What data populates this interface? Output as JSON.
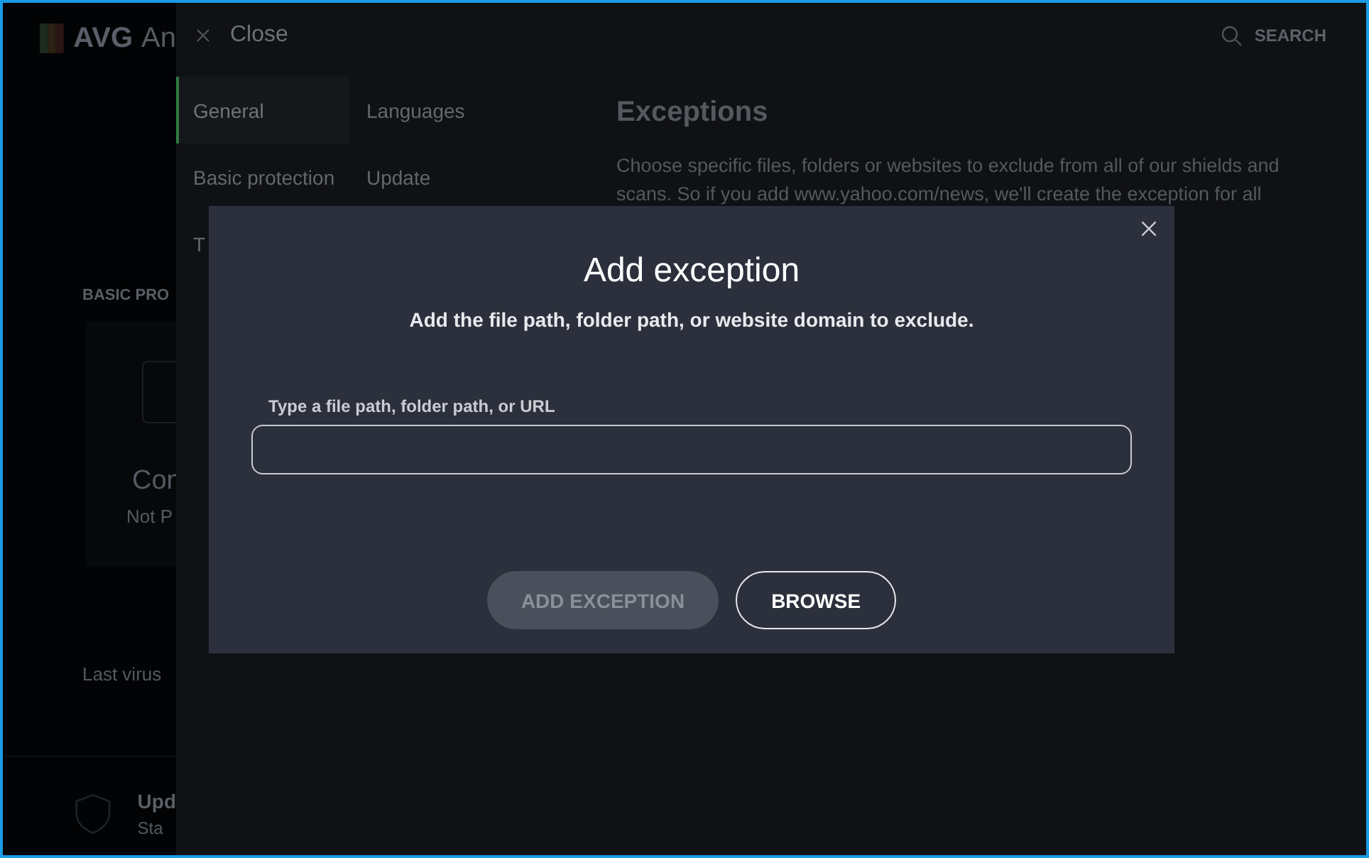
{
  "background_app": {
    "logo": "AVG",
    "title": "An",
    "section_title": "BASIC PRO",
    "card_title": "Con",
    "card_status": "Not P",
    "last_scan": "Last virus",
    "footer_title": "Upd",
    "footer_subtitle": "Sta"
  },
  "settings": {
    "close_label": "Close",
    "search_label": "SEARCH",
    "nav": [
      {
        "label": "General",
        "selected": true
      },
      {
        "label": "Languages",
        "selected": false
      },
      {
        "label": "Basic protection",
        "selected": false
      },
      {
        "label": "Update",
        "selected": false
      },
      {
        "label": "T",
        "selected": false
      }
    ],
    "heading": "Exceptions",
    "description": "Choose specific files, folders or websites to exclude from all of our shields and scans. So if you add www.yahoo.com/news, we'll create the exception for all"
  },
  "dialog": {
    "title": "Add exception",
    "subtitle": "Add the file path, folder path, or website domain to exclude.",
    "field_label": "Type a file path, folder path, or URL",
    "buttons": [
      {
        "label": "ADD EXCEPTION",
        "disabled": true
      },
      {
        "label": "BROWSE",
        "disabled": false
      }
    ]
  }
}
